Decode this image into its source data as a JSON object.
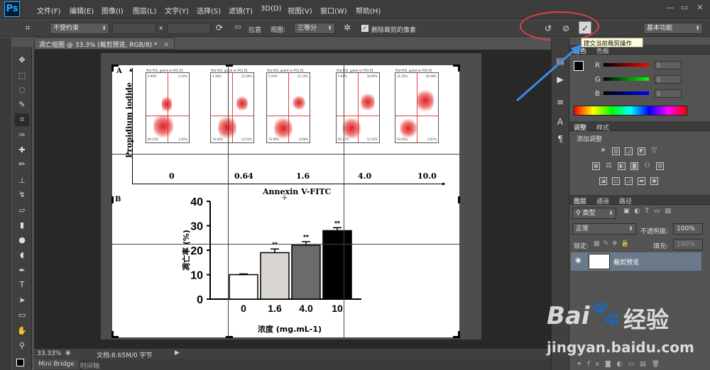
{
  "app": {
    "logo": "Ps",
    "window_controls": [
      "—",
      "▭",
      "✕"
    ]
  },
  "menu": [
    "文件(F)",
    "编辑(E)",
    "图像(I)",
    "图层(L)",
    "文字(Y)",
    "选择(S)",
    "滤镜(T)",
    "3D(D)",
    "视图(V)",
    "窗口(W)",
    "帮助(H)"
  ],
  "options": {
    "ratio": "不受约束",
    "x_sep": "x",
    "straighten": "拉直",
    "view_label": "视图:",
    "view_value": "三等分",
    "delete_cropped": "删除裁剪的像素",
    "workspace": "基本功能",
    "commit_tooltip": "提交当前裁剪操作"
  },
  "document": {
    "tab_title": "凋亡组图 @ 33.3% (裁剪预览, RGB/8) *",
    "zoom": "33.33%",
    "doc_size": "文档:8.65M/0 字节"
  },
  "figure": {
    "panel_a": "A",
    "panel_b": "B",
    "y_axis_a": "Propidium iodide",
    "x_axis_a": "Annexin V-FITC",
    "plot_headers": [
      "Plot P01, gated on P01.R1",
      "Plot P02, gated on P01.R1",
      "Plot P02, gated on P01.R1",
      "Plot P02, gated on P01.R1",
      "Plot P02, gated on P01.R1"
    ],
    "quad_ul": [
      "4.90%",
      "4.18%",
      "5.93%",
      "5.64%",
      "11.52%"
    ],
    "quad_ur": [
      "0.34%",
      "12.00%",
      "11.13%",
      "18.89%",
      "44.98%"
    ],
    "quad_ll": [
      "84.23%",
      "70.93%",
      "73.99%",
      "62.77%",
      "33.05%"
    ],
    "quad_lr": [
      "1.83%",
      "13.52%",
      "8.96%",
      "12.93%",
      "9.87%"
    ],
    "plot_x_label": "Green-B Fluor... (GRN-B-HLog)",
    "plot_y_label": "Red-B Fluorescence (RED-B-HLog)",
    "concentrations": [
      "0",
      "0.64",
      "1.6",
      "4.0",
      "10.0"
    ]
  },
  "chart_data": {
    "type": "bar",
    "categories": [
      "0",
      "1.6",
      "4.0",
      "10"
    ],
    "values": [
      10,
      19,
      22,
      28
    ],
    "errors": [
      0.3,
      1.5,
      1.5,
      1.2
    ],
    "significance": [
      "",
      "**",
      "**",
      "**"
    ],
    "bar_colors": [
      "#ffffff",
      "#d9d6d2",
      "#6b6b6b",
      "#000000"
    ],
    "ylabel": "凋亡率 (%)",
    "xlabel": "浓度 (mg.mL-1)",
    "ylim": [
      0,
      40
    ],
    "yticks": [
      0,
      10,
      20,
      30,
      40
    ]
  },
  "panels": {
    "color": {
      "tabs": [
        "颜色",
        "色板"
      ],
      "channels": [
        "R",
        "G",
        "B"
      ],
      "values": [
        "0",
        "0",
        "0"
      ]
    },
    "adjust": {
      "tabs": [
        "调整",
        "样式"
      ],
      "heading": "添加调整"
    },
    "layers": {
      "tabs": [
        "图层",
        "通道",
        "路径"
      ],
      "filter": "类型",
      "blend": "正常",
      "opacity_label": "不透明度:",
      "opacity": "100%",
      "lock_label": "锁定:",
      "fill_label": "填充:",
      "fill": "100%",
      "layer_name": "裁剪预览"
    }
  },
  "bottom_tabs": [
    "Mini Bridge",
    "时间轴"
  ],
  "watermark": {
    "brand": "Bai",
    "brand2": "经验",
    "url": "jingyan.baidu.com"
  },
  "colors": {
    "accent_red": "#e04040",
    "arrow_blue": "#3a8ee6"
  }
}
